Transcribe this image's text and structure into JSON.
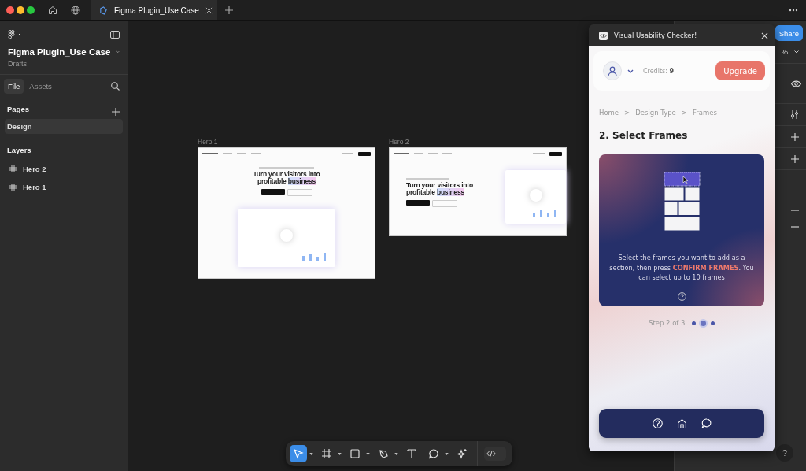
{
  "browser_tabs": [
    {
      "label": "Figma Plugin_Use Case",
      "selected": true
    }
  ],
  "sidebar": {
    "file_name": "Figma Plugin_Use Case",
    "location": "Drafts",
    "tabs": [
      {
        "label": "File",
        "selected": true
      },
      {
        "label": "Assets",
        "selected": false
      }
    ],
    "pages_heading": "Pages",
    "pages": [
      {
        "label": "Design",
        "selected": true
      }
    ],
    "layers_heading": "Layers",
    "layers": [
      {
        "label": "Hero 2",
        "selected": false
      },
      {
        "label": "Hero 1",
        "selected": false
      }
    ]
  },
  "canvas": {
    "frames": [
      {
        "label": "Hero 1",
        "kind": "centered",
        "headline": "Turn your visitors into profitable",
        "highlight": "business"
      },
      {
        "label": "Hero 2",
        "kind": "split",
        "headline": "Turn your visitors into profitable",
        "highlight": "business"
      }
    ]
  },
  "toolbar": {
    "tools": [
      {
        "kind": "move",
        "selected": true,
        "menu": true
      },
      {
        "kind": "frame",
        "selected": false,
        "menu": true
      },
      {
        "kind": "rectangle",
        "selected": false,
        "menu": true
      },
      {
        "kind": "pen",
        "selected": false,
        "menu": true
      },
      {
        "kind": "text",
        "selected": false,
        "menu": false
      },
      {
        "kind": "comment",
        "selected": false,
        "menu": true
      },
      {
        "kind": "actions",
        "selected": false,
        "menu": false
      }
    ],
    "dev_mode": false
  },
  "right_panel": {
    "share_button": "Share",
    "zoom": "%"
  },
  "plugin": {
    "title": "Visual Usability Checker!",
    "credits_label": "Credits:",
    "credits": "9",
    "upgrade_button": "Upgrade",
    "breadcrumb": [
      "Home",
      "Design Type",
      "Frames"
    ],
    "separator": ">",
    "heading": "2. Select Frames",
    "instructions": "Select the frames you want to add as a section, then press **CONFIRM FRAMES**. You can select up to 10 frames",
    "step": "Step 2 of 3",
    "steps": [
      {
        "selected": false
      },
      {
        "selected": true
      },
      {
        "selected": false
      }
    ]
  },
  "help_button": "?"
}
